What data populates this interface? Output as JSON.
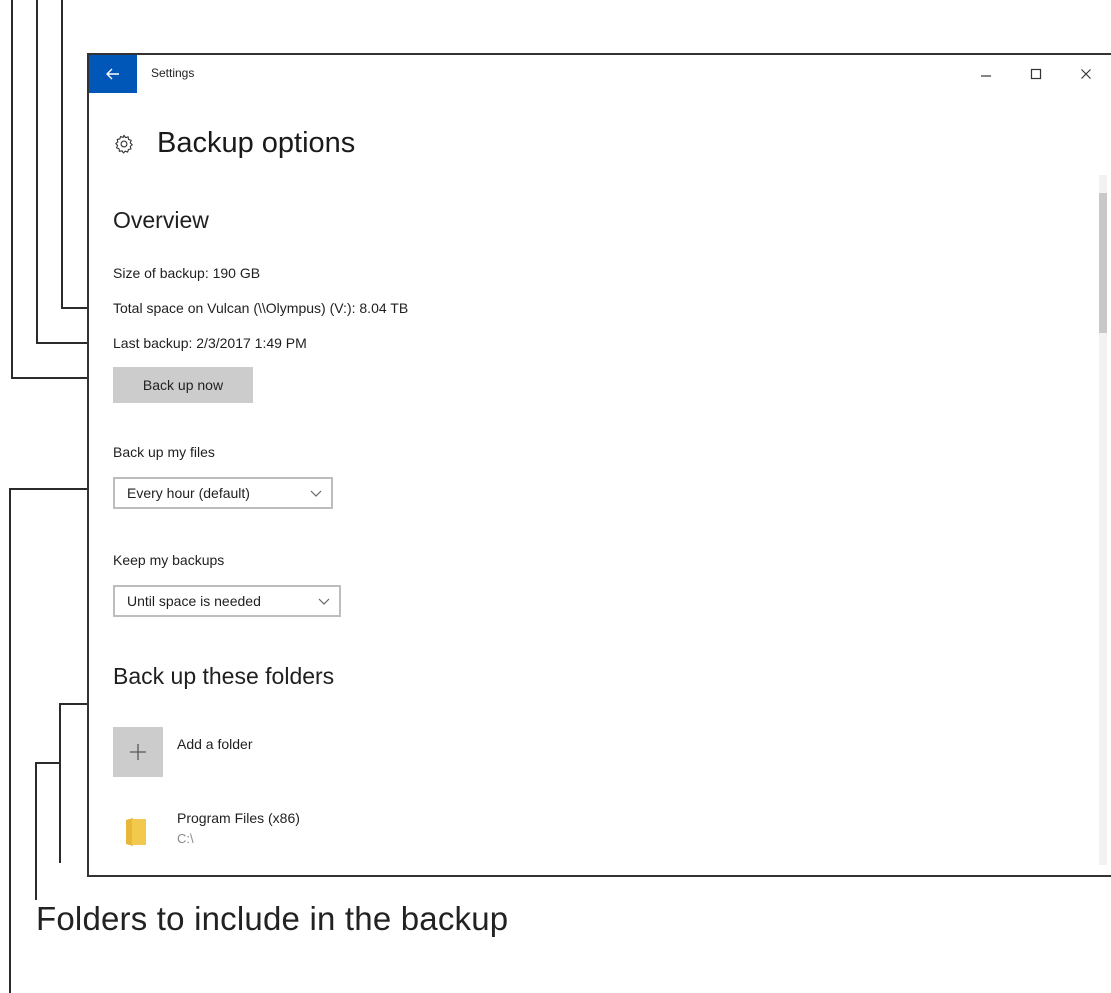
{
  "annotation": {
    "caption": "Folders to include in the backup"
  },
  "window": {
    "title": "Settings",
    "back_icon": "arrow-left-icon",
    "controls": [
      "minimize-icon",
      "maximize-icon",
      "close-icon"
    ]
  },
  "page": {
    "title": "Backup options",
    "icon": "gear-icon"
  },
  "overview": {
    "heading": "Overview",
    "size_of_backup": "Size of backup: 190 GB",
    "total_space": "Total space on Vulcan (\\\\Olympus) (V:): 8.04 TB",
    "last_backup": "Last backup: 2/3/2017 1:49 PM",
    "back_up_now_label": "Back up now"
  },
  "schedule": {
    "frequency_label": "Back up my files",
    "frequency_value": "Every hour (default)",
    "retention_label": "Keep my backups",
    "retention_value": "Until space is needed"
  },
  "folders": {
    "heading": "Back up these folders",
    "add_label": "Add a folder",
    "items": [
      {
        "name": "Program Files (x86)",
        "path": "C:\\",
        "icon": "folder-icon",
        "color": "#f2c94c"
      }
    ]
  },
  "colors": {
    "accent": "#0057b8",
    "button_gray": "#cccccc"
  }
}
